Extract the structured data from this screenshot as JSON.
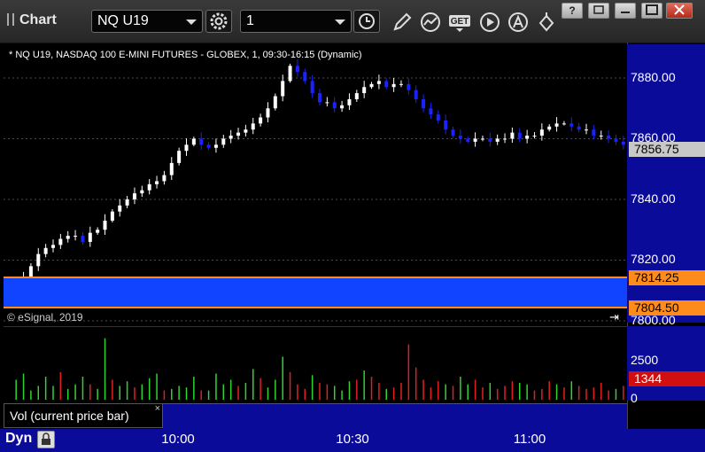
{
  "window": {
    "title": "Chart",
    "symbol": "NQ U19",
    "interval": "1",
    "controls": [
      "minimize",
      "restore",
      "maximize",
      "close"
    ],
    "help_label": "?"
  },
  "toolbar": {
    "icons": [
      "gear-icon",
      "clock-icon",
      "pencil-icon",
      "study-icon",
      "get-icon",
      "play-icon",
      "alert-icon",
      "tools-icon"
    ]
  },
  "chart_data": {
    "type": "candlestick",
    "title": "* NQ U19, NASDAQ 100 E-MINI FUTURES - GLOBEX, 1, 09:30-16:15 (Dynamic)",
    "y_ticks": [
      "7880.00",
      "7860.00",
      "7840.00",
      "7820.00",
      "7800.00"
    ],
    "ylim": [
      7800,
      7887
    ],
    "x_ticks": [
      "10:00",
      "10:30",
      "11:00"
    ],
    "last_price": "7856.75",
    "band_high": "7814.25",
    "band_low": "7804.50",
    "colors": {
      "up": "#ffffff",
      "down": "#1a22ff",
      "band": "#1144ff",
      "band_edge": "#ff8c1a",
      "axis": "#0b0b9a"
    },
    "close_path": [
      7811,
      7814,
      7818,
      7822,
      7824,
      7825,
      7827,
      7828,
      7828,
      7826,
      7829,
      7830,
      7833,
      7836,
      7838,
      7840,
      7842,
      7843,
      7845,
      7846,
      7848,
      7852,
      7856,
      7858,
      7860,
      7858,
      7857,
      7858,
      7860,
      7861,
      7862,
      7863,
      7865,
      7867,
      7870,
      7874,
      7879,
      7884,
      7882,
      7879,
      7875,
      7872,
      7872,
      7870,
      7871,
      7873,
      7875,
      7877,
      7878,
      7879,
      7877,
      7878,
      7878,
      7876,
      7873,
      7870,
      7868,
      7866,
      7863,
      7861,
      7860,
      7859,
      7860,
      7860,
      7859,
      7860,
      7860,
      7862,
      7860,
      7861,
      7861,
      7863,
      7864,
      7865,
      7865,
      7864,
      7863,
      7863,
      7861,
      7861,
      7860,
      7859,
      7858
    ]
  },
  "status": {
    "copyright": "© eSignal, 2019"
  },
  "volume": {
    "label": "Vol (current price bar)",
    "close_label": "×",
    "y_ticks": [
      "2500",
      "0"
    ],
    "ylim": [
      0,
      4500
    ],
    "current": "1344",
    "values": [
      1300,
      1700,
      600,
      900,
      1500,
      900,
      1800,
      700,
      1000,
      1500,
      1000,
      700,
      4000,
      1300,
      900,
      1200,
      800,
      1000,
      1400,
      1700,
      600,
      700,
      900,
      800,
      1500,
      600,
      600,
      1700,
      1000,
      1300,
      900,
      1100,
      2000,
      1400,
      800,
      1300,
      2800,
      1800,
      1000,
      700,
      1600,
      1100,
      1000,
      900,
      600,
      1200,
      1300,
      1900,
      1500,
      1100,
      700,
      800,
      1100,
      3600,
      2100,
      1300,
      800,
      1200,
      1000,
      900,
      1500,
      1000,
      1300,
      800,
      1100,
      700,
      900,
      1200,
      1100,
      1000,
      600,
      700,
      1200,
      1000,
      800,
      1200,
      900,
      700,
      800,
      1100,
      600,
      700,
      900
    ],
    "dir": [
      1,
      1,
      1,
      1,
      1,
      1,
      0,
      1,
      1,
      1,
      0,
      1,
      1,
      0,
      1,
      1,
      0,
      1,
      1,
      1,
      0,
      1,
      1,
      1,
      1,
      0,
      1,
      1,
      1,
      1,
      0,
      1,
      1,
      0,
      1,
      1,
      1,
      0,
      0,
      0,
      1,
      0,
      0,
      1,
      1,
      1,
      0,
      1,
      0,
      0,
      1,
      0,
      0,
      0,
      0,
      0,
      0,
      0,
      1,
      0,
      1,
      1,
      0,
      0,
      1,
      0,
      0,
      0,
      1,
      1,
      0,
      0,
      0,
      1,
      0,
      1,
      0,
      0,
      0,
      0,
      0,
      1,
      0
    ]
  },
  "footer": {
    "mode": "Dyn"
  }
}
